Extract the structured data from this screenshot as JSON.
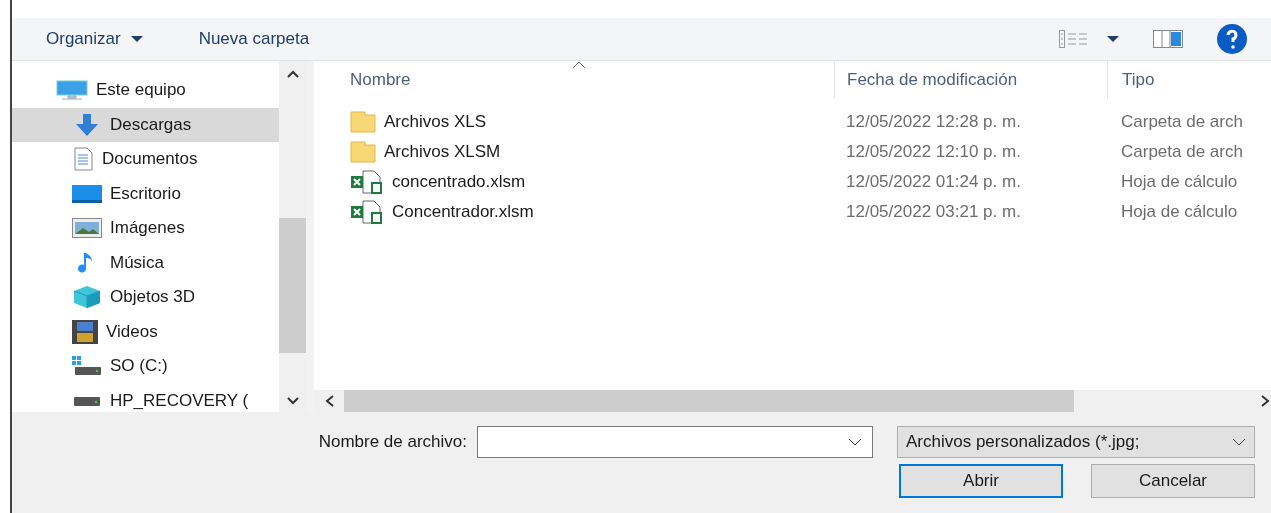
{
  "toolbar": {
    "organize": "Organizar",
    "new_folder": "Nueva carpeta"
  },
  "sidebar": {
    "items": [
      {
        "label": "Este equipo",
        "kind": "computer",
        "selected": false
      },
      {
        "label": "Descargas",
        "kind": "download",
        "selected": true
      },
      {
        "label": "Documentos",
        "kind": "documents",
        "selected": false
      },
      {
        "label": "Escritorio",
        "kind": "desktop",
        "selected": false
      },
      {
        "label": "Imágenes",
        "kind": "pictures",
        "selected": false
      },
      {
        "label": "Música",
        "kind": "music",
        "selected": false
      },
      {
        "label": "Objetos 3D",
        "kind": "objects3d",
        "selected": false
      },
      {
        "label": "Videos",
        "kind": "videos",
        "selected": false
      },
      {
        "label": "SO (C:)",
        "kind": "system-drive",
        "selected": false
      },
      {
        "label": "HP_RECOVERY (",
        "kind": "drive",
        "selected": false
      }
    ]
  },
  "table": {
    "columns": [
      "Nombre",
      "Fecha de modificación",
      "Tipo"
    ],
    "rows": [
      {
        "name": "Archivos XLS",
        "kind": "folder",
        "date": "12/05/2022 12:28 p. m.",
        "type": "Carpeta de arch"
      },
      {
        "name": "Archivos XLSM",
        "kind": "folder",
        "date": "12/05/2022 12:10 p. m.",
        "type": "Carpeta de arch"
      },
      {
        "name": "concentrado.xlsm",
        "kind": "excel",
        "date": "12/05/2022 01:24 p. m.",
        "type": "Hoja de cálculo"
      },
      {
        "name": "Concentrador.xlsm",
        "kind": "excel",
        "date": "12/05/2022 03:21 p. m.",
        "type": "Hoja de cálculo"
      }
    ]
  },
  "file_name": {
    "label": "Nombre de archivo:"
  },
  "filter": {
    "value": "Archivos personalizados (*.jpg;"
  },
  "buttons": [
    "Abrir",
    "Cancelar"
  ]
}
